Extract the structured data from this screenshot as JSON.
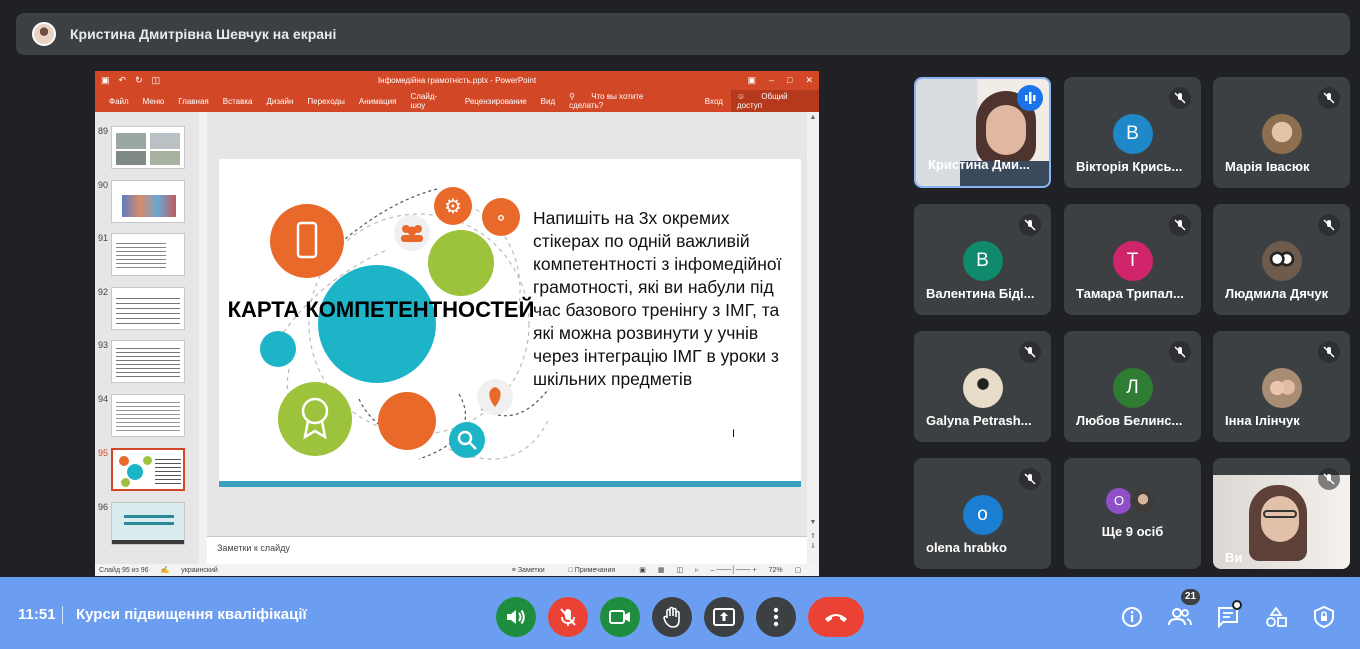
{
  "presenter_banner": {
    "text": "Кристина Дмитрівна Шевчук на екрані"
  },
  "powerpoint": {
    "document_title": "Інфомедійна грамотність.pptx - PowerPoint",
    "menu": [
      "Файл",
      "Меню",
      "Главная",
      "Вставка",
      "Дизайн",
      "Переходы",
      "Анимация",
      "Слайд-шоу",
      "Рецензирование",
      "Вид"
    ],
    "tell_me": "Что вы хотите сделать?",
    "sign_in": "Вход",
    "share": "Общий доступ",
    "thumbnails": [
      "89",
      "90",
      "91",
      "92",
      "93",
      "94",
      "95",
      "96"
    ],
    "selected_slide": "95",
    "notes_placeholder": "Заметки к слайду",
    "status": {
      "slide_counter": "Слайд 95 из 96",
      "language": "украинский",
      "notes": "Заметки",
      "comments": "Примечания",
      "zoom": "72%"
    }
  },
  "slide": {
    "title": "КАРТА КОМПЕТЕНТНОСТЕЙ",
    "body": "Напишіть на 3х окремих стікерах по одній важливій компетентності з інфомедійної грамотності, які ви набули під час базового тренінгу з ІМГ, та які можна розвинути у учнів через інтеграцію ІМГ в уроки з шкільних предметів",
    "colors": {
      "orange": "#e8692a",
      "teal": "#1eb4c8",
      "green": "#9dc23b",
      "accent_bar": "#3b9fc1"
    }
  },
  "participants": [
    {
      "name": "Кристина Дми...",
      "type": "video",
      "speaking": true
    },
    {
      "name": "Вікторія Крись...",
      "initial": "В",
      "color": "#1e88c8",
      "muted": true
    },
    {
      "name": "Марія Івасюк",
      "type": "photo",
      "muted": true
    },
    {
      "name": "Валентина Біді...",
      "initial": "В",
      "color": "#0f8a6c",
      "muted": true
    },
    {
      "name": "Тамара Трипал...",
      "initial": "Т",
      "color": "#d0256a",
      "muted": true
    },
    {
      "name": "Людмила Дячук",
      "type": "photo",
      "muted": true
    },
    {
      "name": "Galyna Petrash...",
      "type": "photo",
      "muted": true
    },
    {
      "name": "Любов Белинс...",
      "initial": "Л",
      "color": "#2e7d32",
      "muted": true
    },
    {
      "name": "Інна Ілінчук",
      "type": "photo",
      "muted": true
    },
    {
      "name": "olena hrabko",
      "initial": "o",
      "color": "#1a7fd0",
      "muted": true
    },
    {
      "name": "Ще 9 осіб",
      "type": "more"
    },
    {
      "name": "Ви",
      "type": "video",
      "muted": true
    }
  ],
  "bottom_bar": {
    "time": "11:51",
    "meeting_name": "Курси підвищення кваліфікації",
    "participant_count": "21",
    "more_initial": "О"
  }
}
